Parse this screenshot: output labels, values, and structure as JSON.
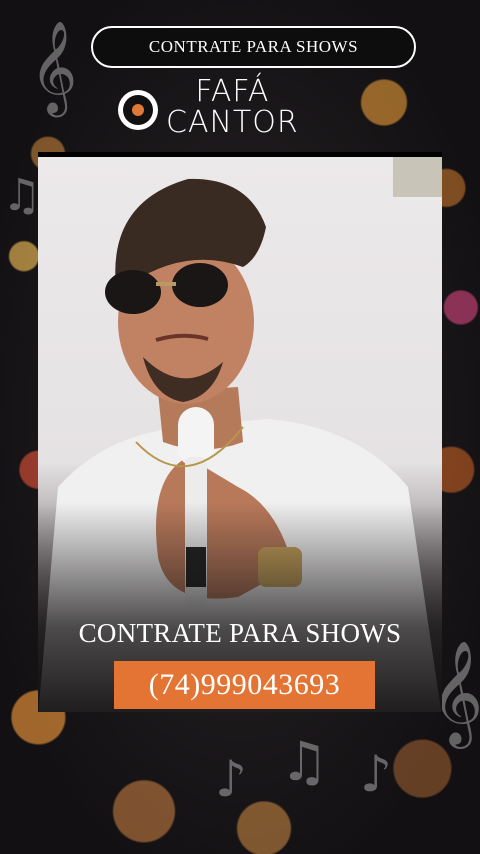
{
  "header": {
    "cta_label": "CONTRATE PARA SHOWS"
  },
  "brand": {
    "line1": "FAFÁ",
    "line2": "CANTOR",
    "logo_icon": "vinyl-record-icon",
    "accent_color": "#e37434"
  },
  "promo": {
    "headline": "CONTRATE PARA SHOWS",
    "phone": "(74)999043693"
  },
  "decor": {
    "note_icon": "music-note-icon",
    "treble_icon": "treble-clef-icon"
  }
}
